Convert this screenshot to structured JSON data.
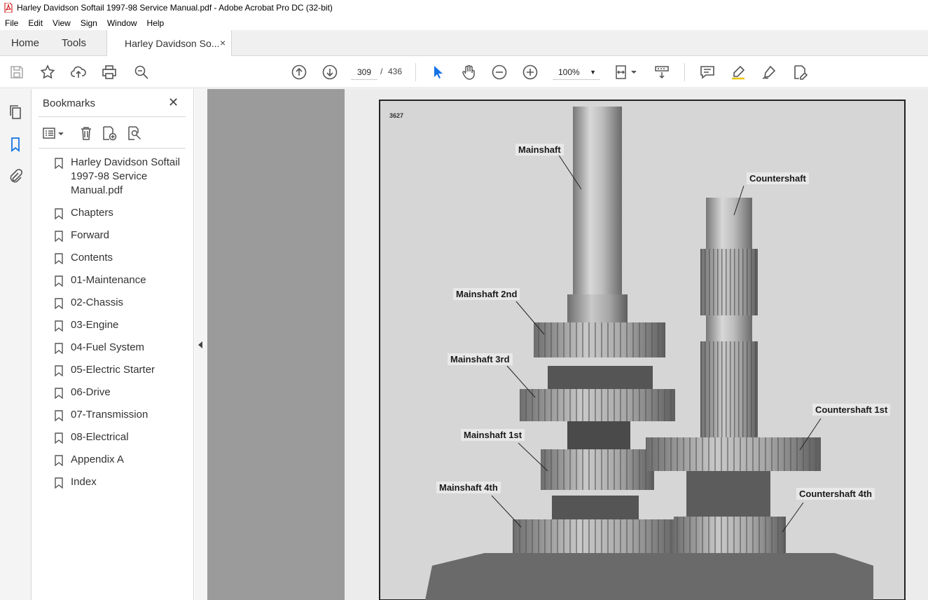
{
  "window": {
    "title": "Harley Davidson Softail 1997-98 Service Manual.pdf - Adobe Acrobat Pro DC (32-bit)"
  },
  "menu": [
    "File",
    "Edit",
    "View",
    "Sign",
    "Window",
    "Help"
  ],
  "tabs": {
    "home": "Home",
    "tools": "Tools",
    "document": "Harley Davidson So...",
    "close_glyph": "×"
  },
  "toolbar": {
    "page_current": "309",
    "page_separator": "/",
    "page_total": "436",
    "zoom": "100%",
    "zoom_caret": "▼"
  },
  "bookmarks": {
    "title": "Bookmarks",
    "close_glyph": "✕",
    "items": [
      "Harley Davidson Softail 1997-98 Service Manual.pdf",
      "Chapters",
      "Forward",
      "Contents",
      "01-Maintenance",
      "02-Chassis",
      "03-Engine",
      "04-Fuel System",
      "05-Electric Starter",
      "06-Drive",
      "07-Transmission",
      "08-Electrical",
      "Appendix A",
      "Index"
    ]
  },
  "figure": {
    "number": "3627",
    "labels": {
      "mainshaft": "Mainshaft",
      "countershaft": "Countershaft",
      "mainshaft_2nd": "Mainshaft 2nd",
      "mainshaft_3rd": "Mainshaft 3rd",
      "mainshaft_1st": "Mainshaft 1st",
      "mainshaft_4th": "Mainshaft 4th",
      "countershaft_1st": "Countershaft 1st",
      "countershaft_4th": "Countershaft 4th"
    }
  },
  "colors": {
    "accent": "#1473e6",
    "doc_background": "#9b9b9b",
    "icon": "#555555"
  }
}
